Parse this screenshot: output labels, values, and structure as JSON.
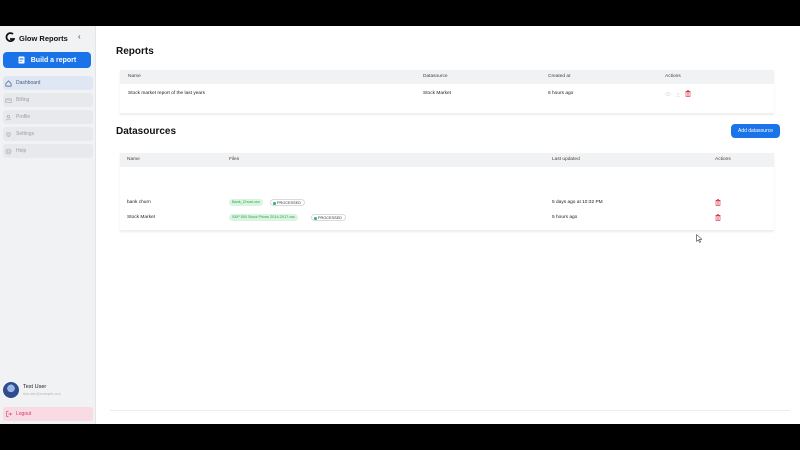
{
  "app": {
    "title": "Glow Reports",
    "brand_color": "#1a73e8",
    "collapse_icon": "chevron-left-icon"
  },
  "sidebar": {
    "build_label": "Build a report",
    "items": [
      {
        "label": "Dashboard",
        "icon": "home-icon",
        "active": true
      },
      {
        "label": "Billing",
        "icon": "credit-card-icon",
        "active": false
      },
      {
        "label": "Profile",
        "icon": "user-icon",
        "active": false
      },
      {
        "label": "Settings",
        "icon": "gear-icon",
        "active": false
      },
      {
        "label": "Help",
        "icon": "help-icon",
        "active": false
      }
    ],
    "user": {
      "name": "Test User",
      "email": "test.user@example.com"
    },
    "logout_label": "Logout"
  },
  "reports": {
    "title": "Reports",
    "columns": [
      "Name",
      "Datasource",
      "Created at",
      "Actions"
    ],
    "rows": [
      {
        "name": "Stock market report of the last years",
        "datasource": "Stock Market",
        "created": "6 hours ago"
      }
    ]
  },
  "datasources": {
    "title": "Datasources",
    "add_label": "Add datasource",
    "columns": [
      "Name",
      "Files",
      "Last updated",
      "Actions"
    ],
    "rows": [
      {
        "name": "bank churn",
        "file": "Bank_Churn.csv",
        "status": "PROCESSED",
        "updated": "5 days ago at 10:32 PM"
      },
      {
        "name": "Stock Market",
        "file": "S&P 500 Stock Prices 2014-2017.csv",
        "status": "PROCESSED",
        "updated": "5 hours ago"
      }
    ]
  }
}
